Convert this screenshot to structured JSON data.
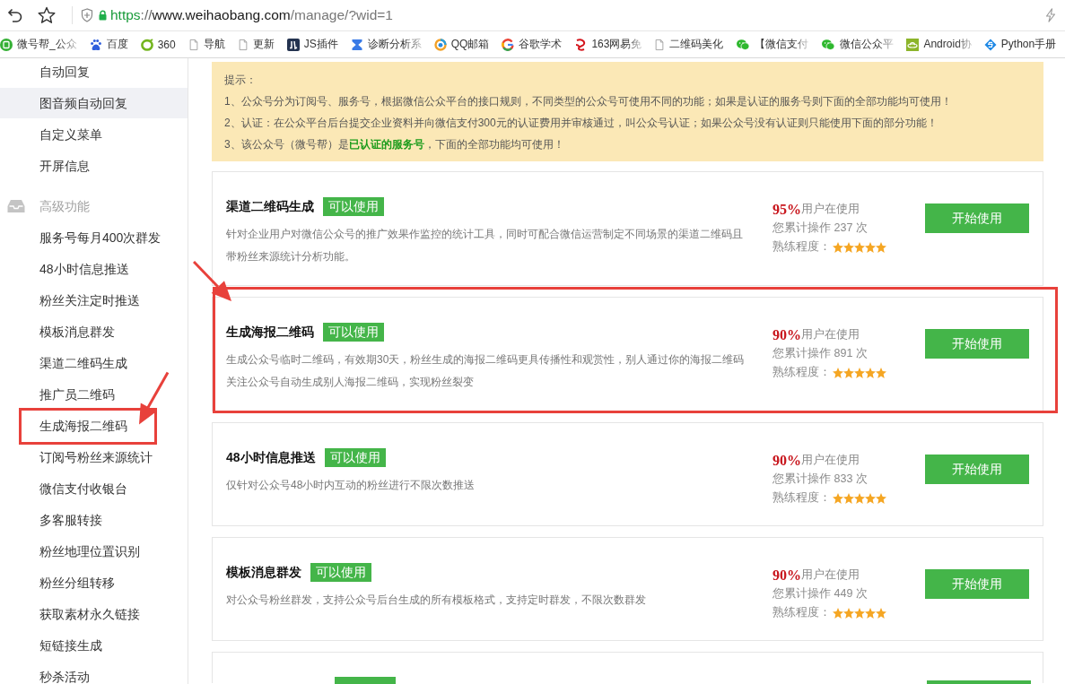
{
  "browser": {
    "url_parts": [
      {
        "kind": "scheme",
        "text": "https"
      },
      {
        "kind": "separator",
        "text": "://"
      },
      {
        "kind": "host",
        "text": "www.weihaobang.com"
      },
      {
        "kind": "path",
        "text": "/manage/?wid=1"
      }
    ]
  },
  "bookmarks": [
    {
      "label": "微号帮_公众",
      "truncated": true
    },
    {
      "label": "百度",
      "truncated": false
    },
    {
      "label": "360",
      "truncated": false
    },
    {
      "label": "导航",
      "truncated": false
    },
    {
      "label": "更新",
      "truncated": false
    },
    {
      "label": "JS插件",
      "truncated": false
    },
    {
      "label": "诊断分析系",
      "truncated": true
    },
    {
      "label": "QQ邮箱",
      "truncated": false
    },
    {
      "label": "谷歌学术",
      "truncated": false
    },
    {
      "label": "163网易免",
      "truncated": true
    },
    {
      "label": "二维码美化",
      "truncated": false
    },
    {
      "label": "【微信支付",
      "truncated": true
    },
    {
      "label": "微信公众平",
      "truncated": true
    },
    {
      "label": "Android协",
      "truncated": true
    },
    {
      "label": "Python手册",
      "truncated": false
    }
  ],
  "sidebar": {
    "items": [
      {
        "label": "自动回复",
        "selected": false,
        "marked": false
      },
      {
        "label": "图音频自动回复",
        "selected": true,
        "marked": false
      },
      {
        "label": "自定义菜单",
        "selected": false,
        "marked": false
      },
      {
        "label": "开屏信息",
        "selected": false,
        "marked": false
      }
    ],
    "section": {
      "title": "高级功能",
      "items": [
        {
          "label": "服务号每月400次群发",
          "selected": false,
          "marked": false
        },
        {
          "label": "48小时信息推送",
          "selected": false,
          "marked": false
        },
        {
          "label": "粉丝关注定时推送",
          "selected": false,
          "marked": false
        },
        {
          "label": "模板消息群发",
          "selected": false,
          "marked": false
        },
        {
          "label": "渠道二维码生成",
          "selected": false,
          "marked": false
        },
        {
          "label": "推广员二维码",
          "selected": false,
          "marked": false
        },
        {
          "label": "生成海报二维码",
          "selected": false,
          "marked": true
        },
        {
          "label": "订阅号粉丝来源统计",
          "selected": false,
          "marked": false
        },
        {
          "label": "微信支付收银台",
          "selected": false,
          "marked": false
        },
        {
          "label": "多客服转接",
          "selected": false,
          "marked": false
        },
        {
          "label": "粉丝地理位置识别",
          "selected": false,
          "marked": false
        },
        {
          "label": "粉丝分组转移",
          "selected": false,
          "marked": false
        },
        {
          "label": "获取素材永久链接",
          "selected": false,
          "marked": false
        },
        {
          "label": "短链接生成",
          "selected": false,
          "marked": false
        },
        {
          "label": "秒杀活动",
          "selected": false,
          "marked": false
        }
      ]
    }
  },
  "notice": {
    "title": "提示：",
    "lines": [
      "1、公众号分为订阅号、服务号，根据微信公众平台的接口规则，不同类型的公众号可使用不同的功能；如果是认证的服务号则下面的全部功能均可使用！",
      "2、认证：在公众平台后台提交企业资料并向微信支付300元的认证费用并审核通过，叫公众号认证；如果公众号没有认证则只能使用下面的部分功能！",
      "3、该公众号（微号帮）是**已认证的服务号**，下面的全部功能均可使用！"
    ]
  },
  "features": [
    {
      "title": "渠道二维码生成",
      "badge": "可以使用",
      "description": "针对企业用户对微信公众号的推广效果作监控的统计工具，同时可配合微信运营制定不同场景的渠道二维码且带粉丝来源统计分析功能。",
      "percent": "95%",
      "percent_label": "用户在使用",
      "operations": "您累计操作 237 次",
      "skill_label": "熟练程度：",
      "stars": 5,
      "button": "开始使用",
      "marked": false
    },
    {
      "title": "生成海报二维码",
      "badge": "可以使用",
      "description": "生成公众号临时二维码，有效期30天，粉丝生成的海报二维码更具传播性和观赏性，别人通过你的海报二维码关注公众号自动生成别人海报二维码，实现粉丝裂变",
      "percent": "90%",
      "percent_label": "用户在使用",
      "operations": "您累计操作 891 次",
      "skill_label": "熟练程度：",
      "stars": 5,
      "button": "开始使用",
      "marked": true
    },
    {
      "title": "48小时信息推送",
      "badge": "可以使用",
      "description": "仅针对公众号48小时内互动的粉丝进行不限次数推送",
      "percent": "90%",
      "percent_label": "用户在使用",
      "operations": "您累计操作 833 次",
      "skill_label": "熟练程度：",
      "stars": 5,
      "button": "开始使用",
      "marked": false
    },
    {
      "title": "模板消息群发",
      "badge": "可以使用",
      "description": "对公众号粉丝群发，支持公众号后台生成的所有模板格式，支持定时群发，不限次数群发",
      "percent": "90%",
      "percent_label": "用户在使用",
      "operations": "您累计操作 449 次",
      "skill_label": "熟练程度：",
      "stars": 5,
      "button": "开始使用",
      "marked": false
    }
  ],
  "more_below": true
}
